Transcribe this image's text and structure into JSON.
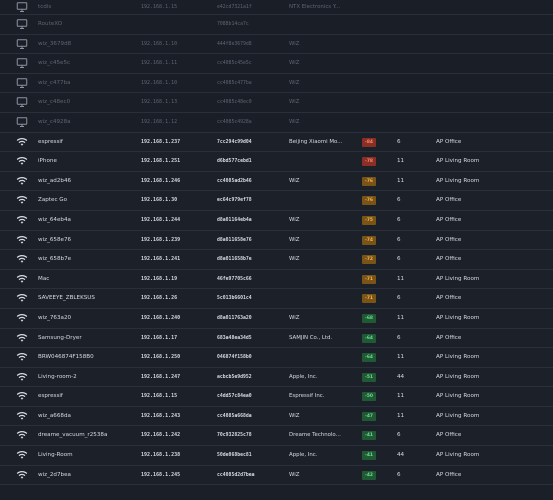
{
  "colors": {
    "signal_red": "#8a2f24",
    "signal_orange": "#7a5417",
    "signal_green": "#1f5a35",
    "wifi_icon": "#d7dbe2",
    "wired_icon": "#8a93a3"
  },
  "clients": [
    {
      "icon": "monitor-icon",
      "offline": true,
      "name": "tcdis",
      "ip": "192.168.1.15",
      "mac": "e42cd7321a1f",
      "vendor": "NTX Electronics Y...",
      "signal": "",
      "signal_level": "",
      "channel": "",
      "ap": ""
    },
    {
      "icon": "monitor-icon",
      "offline": true,
      "name": "RouteXO",
      "ip": "",
      "mac": "7088b14ca7c",
      "vendor": "",
      "signal": "",
      "signal_level": "",
      "channel": "",
      "ap": ""
    },
    {
      "icon": "monitor-icon",
      "offline": true,
      "name": "wiz_3679d8",
      "ip": "192.168.1.10",
      "mac": "444f8e3679d8",
      "vendor": "WiZ",
      "signal": "",
      "signal_level": "",
      "channel": "",
      "ap": ""
    },
    {
      "icon": "monitor-icon",
      "offline": true,
      "name": "wiz_c45e5c",
      "ip": "192.168.1.11",
      "mac": "cc4085c45e5c",
      "vendor": "WiZ",
      "signal": "",
      "signal_level": "",
      "channel": "",
      "ap": ""
    },
    {
      "icon": "monitor-icon",
      "offline": true,
      "name": "wiz_c477ba",
      "ip": "192.168.1.10",
      "mac": "cc4085c477ba",
      "vendor": "WiZ",
      "signal": "",
      "signal_level": "",
      "channel": "",
      "ap": ""
    },
    {
      "icon": "monitor-icon",
      "offline": true,
      "name": "wiz_c48ec0",
      "ip": "192.168.1.13",
      "mac": "cc4085c48ec0",
      "vendor": "WiZ",
      "signal": "",
      "signal_level": "",
      "channel": "",
      "ap": ""
    },
    {
      "icon": "monitor-icon",
      "offline": true,
      "name": "wiz_c4928a",
      "ip": "192.168.1.12",
      "mac": "cc4085c4928a",
      "vendor": "WiZ",
      "signal": "",
      "signal_level": "",
      "channel": "",
      "ap": ""
    },
    {
      "icon": "wifi-icon",
      "offline": false,
      "name": "espressif",
      "ip": "192.168.1.237",
      "mac": "7cc294c99d04",
      "vendor": "Beijing Xiaomi Mo...",
      "signal": "-84",
      "signal_level": "red",
      "channel": "6",
      "ap": "AP Office"
    },
    {
      "icon": "wifi-icon",
      "offline": false,
      "name": "iPhone",
      "ip": "192.168.1.251",
      "mac": "d6bd577cebd1",
      "vendor": "",
      "signal": "-78",
      "signal_level": "red",
      "channel": "11",
      "ap": "AP Living Room"
    },
    {
      "icon": "wifi-icon",
      "offline": false,
      "name": "wiz_ad2b46",
      "ip": "192.168.1.246",
      "mac": "cc4085ad2b46",
      "vendor": "WiZ",
      "signal": "-76",
      "signal_level": "orange",
      "channel": "11",
      "ap": "AP Living Room"
    },
    {
      "icon": "wifi-icon",
      "offline": false,
      "name": "Zaptec Go",
      "ip": "192.168.1.30",
      "mac": "ec64c979ef78",
      "vendor": "",
      "signal": "-76",
      "signal_level": "orange",
      "channel": "6",
      "ap": "AP Office"
    },
    {
      "icon": "wifi-icon",
      "offline": false,
      "name": "wiz_64eb4a",
      "ip": "192.168.1.244",
      "mac": "d8a01164eb4a",
      "vendor": "WiZ",
      "signal": "-75",
      "signal_level": "orange",
      "channel": "6",
      "ap": "AP Office"
    },
    {
      "icon": "wifi-icon",
      "offline": false,
      "name": "wiz_658e76",
      "ip": "192.168.1.239",
      "mac": "d8a011658e76",
      "vendor": "WiZ",
      "signal": "-74",
      "signal_level": "orange",
      "channel": "6",
      "ap": "AP Office"
    },
    {
      "icon": "wifi-icon",
      "offline": false,
      "name": "wiz_658b7e",
      "ip": "192.168.1.241",
      "mac": "d8a011658b7e",
      "vendor": "WiZ",
      "signal": "-72",
      "signal_level": "orange",
      "channel": "6",
      "ap": "AP Office"
    },
    {
      "icon": "wifi-icon",
      "offline": false,
      "name": "Mac",
      "ip": "192.168.1.19",
      "mac": "46fe97705c66",
      "vendor": "",
      "signal": "-71",
      "signal_level": "orange",
      "channel": "11",
      "ap": "AP Living Room"
    },
    {
      "icon": "wifi-icon",
      "offline": false,
      "name": "SAVEEYE_ZBLEKSUS",
      "ip": "192.168.1.26",
      "mac": "5c013b6601c4",
      "vendor": "",
      "signal": "-71",
      "signal_level": "orange",
      "channel": "6",
      "ap": "AP Office"
    },
    {
      "icon": "wifi-icon",
      "offline": false,
      "name": "wiz_763a20",
      "ip": "192.168.1.240",
      "mac": "d8a011763a20",
      "vendor": "WiZ",
      "signal": "-68",
      "signal_level": "green",
      "channel": "11",
      "ap": "AP Living Room"
    },
    {
      "icon": "wifi-icon",
      "offline": false,
      "name": "Samsung-Dryer",
      "ip": "192.168.1.17",
      "mac": "683a48ea34d5",
      "vendor": "SAMJIN Co., Ltd.",
      "signal": "-64",
      "signal_level": "green",
      "channel": "6",
      "ap": "AP Office"
    },
    {
      "icon": "wifi-icon",
      "offline": false,
      "name": "BRW046874F158B0",
      "ip": "192.168.1.250",
      "mac": "046874f158b0",
      "vendor": "",
      "signal": "-64",
      "signal_level": "green",
      "channel": "11",
      "ap": "AP Living Room"
    },
    {
      "icon": "wifi-icon",
      "offline": false,
      "name": "Living-room-2",
      "ip": "192.168.1.247",
      "mac": "acbcb5e9d952",
      "vendor": "Apple, Inc.",
      "signal": "-51",
      "signal_level": "green",
      "channel": "44",
      "ap": "AP Living Room"
    },
    {
      "icon": "wifi-icon",
      "offline": false,
      "name": "espressif",
      "ip": "192.168.1.15",
      "mac": "c4dd57c84ea0",
      "vendor": "Espressif Inc.",
      "signal": "-50",
      "signal_level": "green",
      "channel": "11",
      "ap": "AP Living Room"
    },
    {
      "icon": "wifi-icon",
      "offline": false,
      "name": "wiz_a668da",
      "ip": "192.168.1.243",
      "mac": "cc4085a668da",
      "vendor": "WiZ",
      "signal": "-47",
      "signal_level": "green",
      "channel": "11",
      "ap": "AP Living Room"
    },
    {
      "icon": "wifi-icon",
      "offline": false,
      "name": "dreame_vacuum_r2538a",
      "ip": "192.168.1.242",
      "mac": "70c932825c78",
      "vendor": "Dreame Technolo...",
      "signal": "-41",
      "signal_level": "green",
      "channel": "6",
      "ap": "AP Office"
    },
    {
      "icon": "wifi-icon",
      "offline": false,
      "name": "Living-Room",
      "ip": "192.168.1.238",
      "mac": "50de068bec81",
      "vendor": "Apple, Inc.",
      "signal": "-41",
      "signal_level": "green",
      "channel": "44",
      "ap": "AP Living Room"
    },
    {
      "icon": "wifi-icon",
      "offline": false,
      "name": "wiz_2d7bea",
      "ip": "192.168.1.245",
      "mac": "cc4085d2d7bea",
      "vendor": "WiZ",
      "signal": "-42",
      "signal_level": "green",
      "channel": "6",
      "ap": "AP Office"
    }
  ]
}
